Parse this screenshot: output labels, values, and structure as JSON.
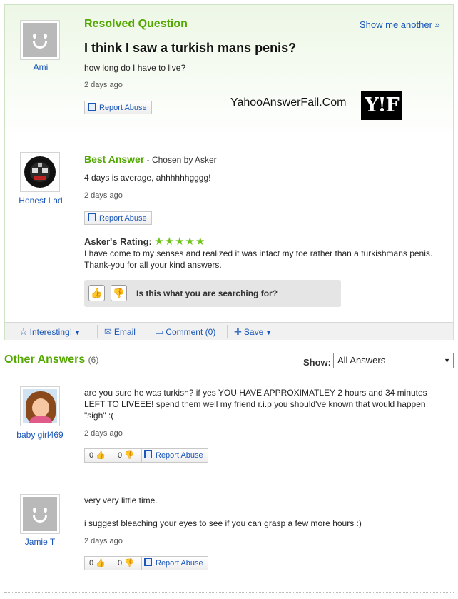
{
  "question": {
    "label": "Resolved Question",
    "show_another": "Show me another »",
    "title": "I think I saw a turkish mans penis?",
    "body": "how long do I have to live?",
    "time": "2 days ago",
    "asker": "Ami",
    "report": "Report Abuse"
  },
  "watermark": {
    "site": "YahooAnswerFail.Com",
    "logo": "Y!F"
  },
  "best_answer": {
    "label": "Best Answer",
    "chosen": " - Chosen by Asker",
    "body": "4 days is average, ahhhhhhgggg!",
    "time": "2 days ago",
    "user": "Honest Lad",
    "report": "Report Abuse",
    "rating_label": "Asker's Rating:",
    "rating_stars": "★★★★★",
    "rating": 5,
    "comment": "I have come to my senses and realized it was infact my toe rather than a turkishmans penis. Thank-you for all your kind answers.",
    "search_prompt": "Is this what you are searching for?"
  },
  "toolbar": {
    "interesting": "Interesting!",
    "email": "Email",
    "comment": "Comment (0)",
    "save": "Save"
  },
  "other_answers": {
    "title": "Other Answers",
    "count": "(6)",
    "show_label": "Show:",
    "filter_value": "All Answers",
    "items": [
      {
        "user": "baby girl469",
        "body": "are you sure he was turkish? if yes YOU HAVE APPROXIMATLEY 2 hours and 34 minutes LEFT TO LIVEEE! spend them well my friend r.i.p you should've known that would happen \"sigh\" :(",
        "time": "2 days ago",
        "up": "0",
        "down": "0",
        "report": "Report Abuse"
      },
      {
        "user": "Jamie T",
        "body1": "very very little time.",
        "body2": "i suggest bleaching your eyes to see if you can grasp a few more hours :)",
        "time": "2 days ago",
        "up": "0",
        "down": "0",
        "report": "Report Abuse"
      }
    ]
  },
  "colors": {
    "accent_green": "#53a800",
    "link_blue": "#1a56b8",
    "star_green": "#6cc417"
  }
}
